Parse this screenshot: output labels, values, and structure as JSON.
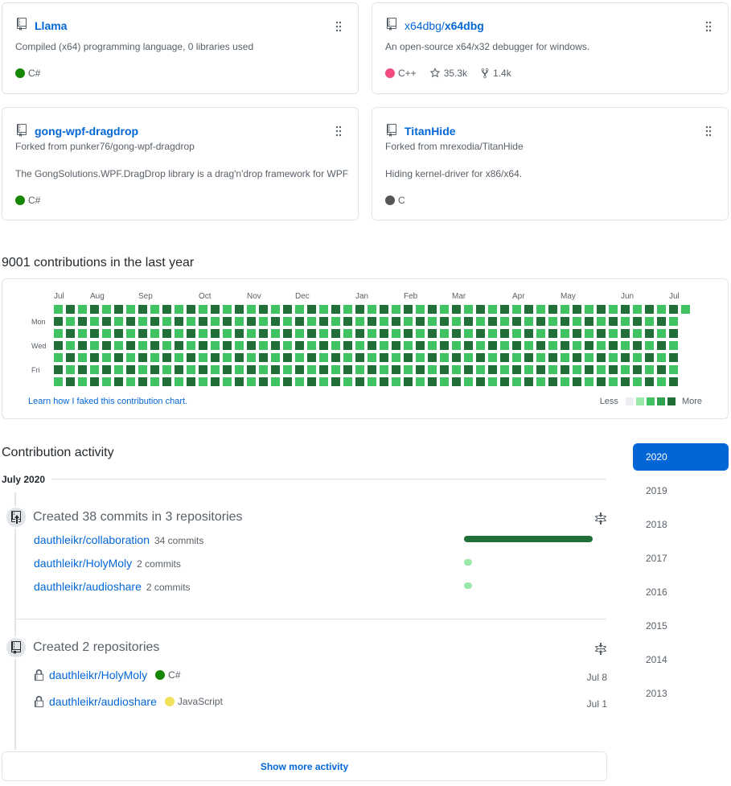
{
  "pinned": [
    {
      "owner": "",
      "name": "Llama",
      "forked_from": "",
      "description": "Compiled (x64) programming language, 0 libraries used",
      "language": "C#",
      "language_color": "#178600",
      "stars": "",
      "forks": ""
    },
    {
      "owner": "x64dbg/",
      "name": "x64dbg",
      "forked_from": "",
      "description": "An open-source x64/x32 debugger for windows.",
      "language": "C++",
      "language_color": "#f34b7d",
      "stars": "35.3k",
      "forks": "1.4k"
    },
    {
      "owner": "",
      "name": "gong-wpf-dragdrop",
      "forked_from": "Forked from punker76/gong-wpf-dragdrop",
      "description": "The GongSolutions.WPF.DragDrop library is a drag'n'drop framework for WPF",
      "language": "C#",
      "language_color": "#178600",
      "stars": "",
      "forks": ""
    },
    {
      "owner": "",
      "name": "TitanHide",
      "forked_from": "Forked from mrexodia/TitanHide",
      "description": "Hiding kernel-driver for x86/x64.",
      "language": "C",
      "language_color": "#555555",
      "stars": "",
      "forks": ""
    }
  ],
  "contributions": {
    "title": "9001 contributions in the last year",
    "months": [
      "Jul",
      "Aug",
      "Sep",
      "Oct",
      "Nov",
      "Dec",
      "Jan",
      "Feb",
      "Mar",
      "Apr",
      "May",
      "Jun",
      "Jul"
    ],
    "day_labels": [
      "Mon",
      "Wed",
      "Fri"
    ],
    "learn_link": "Learn how I faked this contribution chart.",
    "legend_less": "Less",
    "legend_more": "More",
    "colors": [
      "#ebedf0",
      "#9be9a8",
      "#40c463",
      "#30a14e",
      "#216e39"
    ],
    "week_count": 53
  },
  "activity": {
    "title": "Contribution activity",
    "month": "July 2020",
    "commits": {
      "heading": "Created 38 commits in 3 repositories",
      "repos": [
        {
          "name": "dauthleikr/collaboration",
          "count": "34 commits",
          "fraction": 1.0
        },
        {
          "name": "dauthleikr/HolyMoly",
          "count": "2 commits",
          "fraction": 0.06
        },
        {
          "name": "dauthleikr/audioshare",
          "count": "2 commits",
          "fraction": 0.06
        }
      ]
    },
    "repos_created": {
      "heading": "Created 2 repositories",
      "items": [
        {
          "name": "dauthleikr/HolyMoly",
          "language": "C#",
          "language_color": "#178600",
          "date": "Jul 8"
        },
        {
          "name": "dauthleikr/audioshare",
          "language": "JavaScript",
          "language_color": "#f1e05a",
          "date": "Jul 1"
        }
      ]
    },
    "show_more": "Show more activity"
  },
  "years": [
    "2020",
    "2019",
    "2018",
    "2017",
    "2016",
    "2015",
    "2014",
    "2013"
  ],
  "active_year": "2020"
}
